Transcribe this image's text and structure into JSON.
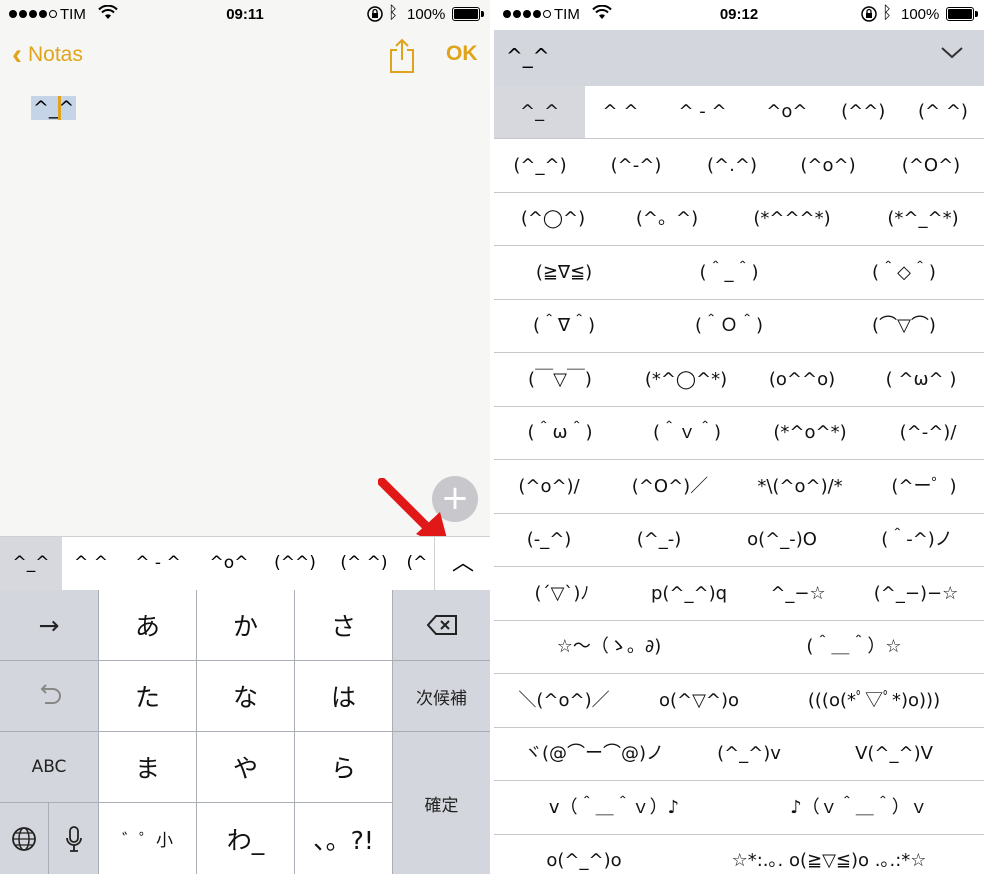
{
  "left_status": {
    "carrier": "TIM",
    "time": "09:11",
    "battery": "100%"
  },
  "right_status": {
    "carrier": "TIM",
    "time": "09:12",
    "battery": "100%"
  },
  "notes": {
    "back_label": "Notas",
    "ok_label": "OK",
    "content": "^_^"
  },
  "candidates_bar": [
    "^_^",
    "^ ^",
    "^ - ^",
    "^o^",
    "(^^)",
    "(^ ^)",
    "(^"
  ],
  "keyboard": {
    "row1": [
      "→",
      "あ",
      "か",
      "さ"
    ],
    "row2": [
      "た",
      "な",
      "は",
      "次候補"
    ],
    "row3": [
      "ABC",
      "ま",
      "や",
      "ら"
    ],
    "row4": [
      "゛゜小",
      "わ_",
      "、。?!",
      "確定"
    ]
  },
  "kaomoji_panel": {
    "header": "^_^",
    "rows": [
      [
        "^_^",
        "^ ^",
        "^ - ^",
        "^o^",
        "(^^)",
        "(^ ^)"
      ],
      [
        "(^_^)",
        "(^-^)",
        "(^.^)",
        "(^o^)",
        "(^O^)"
      ],
      [
        "(^◯^)",
        "(^。^)",
        "(*^^^*)",
        "(*^_^*)"
      ],
      [
        "(≧∇≦)",
        "(＾_＾)",
        "(＾◇＾)"
      ],
      [
        "(＾∇＾)",
        "(＾Ｏ＾)",
        "(⌒▽⌒)"
      ],
      [
        "(￣▽￣)",
        "(*^◯^*)",
        "(o^^o)",
        "( ^ω^ )"
      ],
      [
        "(＾ω＾)",
        "(＾ｖ＾)",
        "(*^o^*)",
        "(^-^)/"
      ],
      [
        "(^o^)/",
        "(^O^)／",
        "*\\(^o^)/*",
        "(^ー゜)"
      ],
      [
        "(-_^)",
        "(^_-)",
        "o(^_-)O",
        "(＾-^)ノ"
      ],
      [
        "(´▽`)ﾉ",
        "p(^_^)q",
        "^_−☆",
        "(^_−)−☆"
      ],
      [
        "☆〜（ゝ。∂)",
        "(＾＿＾）☆"
      ],
      [
        "＼(^o^)／",
        "o(^▽^)o",
        "(((o(*ﾟ▽ﾟ*)o)))"
      ],
      [
        "ヾ(@⌒ー⌒@)ノ",
        "(^_^)v",
        "V(^_^)V"
      ],
      [
        "v（＾＿＾ｖ）♪",
        "♪（ｖ＾＿＾）ｖ"
      ],
      [
        "o(^_^)o",
        "☆*:.｡. o(≧▽≦)o .｡.:*☆"
      ]
    ]
  }
}
